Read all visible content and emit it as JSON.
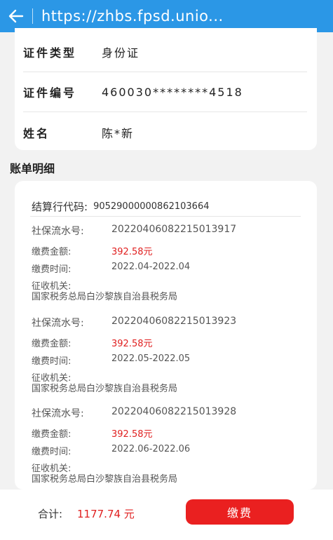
{
  "browser": {
    "url": "https://zhbs.fpsd.unio..."
  },
  "identity": {
    "doc_type_label": "证件类型",
    "doc_type_value": "身份证",
    "doc_number_label": "证件编号",
    "doc_number_value": "460030********4518",
    "name_label": "姓名",
    "name_value": "陈*新"
  },
  "bill": {
    "section_title": "账单明细",
    "code_label": "结算行代码:",
    "code_value": "90529000000862103664",
    "serial_label": "社保流水号:",
    "amount_label": "缴费金额:",
    "period_label": "缴费时间:",
    "org_label": "征收机关:",
    "records": [
      {
        "serial": "20220406082215013917",
        "amount": "392.58元",
        "period": "2022.04-2022.04",
        "org": "国家税务总局白沙黎族自治县税务局"
      },
      {
        "serial": "20220406082215013923",
        "amount": "392.58元",
        "period": "2022.05-2022.05",
        "org": "国家税务总局白沙黎族自治县税务局"
      },
      {
        "serial": "20220406082215013928",
        "amount": "392.58元",
        "period": "2022.06-2022.06",
        "org": "国家税务总局白沙黎族自治县税务局"
      }
    ]
  },
  "footer": {
    "total_label": "合计:",
    "total_value": "1177.74 元",
    "pay_label": "缴费"
  },
  "colors": {
    "topbar": "#2b97e6",
    "accent_red": "#e02020"
  },
  "icons": {
    "back": "arrow-left-icon"
  }
}
